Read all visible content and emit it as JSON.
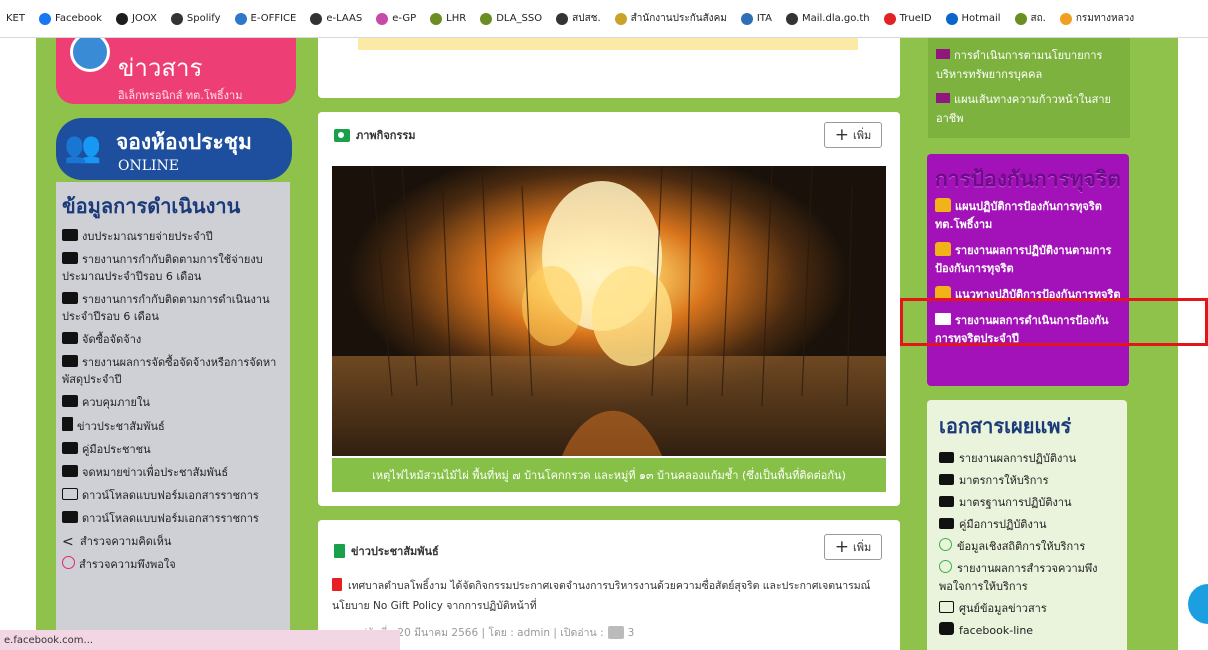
{
  "bookmarks": [
    {
      "label": "KET",
      "icon": "none",
      "color": ""
    },
    {
      "label": "Facebook",
      "icon": "facebook-icon",
      "color": "#1877f2"
    },
    {
      "label": "JOOX",
      "icon": "joox-icon",
      "color": "#1d1d1d"
    },
    {
      "label": "Spolify",
      "icon": "globe-icon",
      "color": "#333333"
    },
    {
      "label": "E-OFFICE",
      "icon": "eoffice-icon",
      "color": "#2f77c8"
    },
    {
      "label": "e-LAAS",
      "icon": "globe-icon",
      "color": "#333333"
    },
    {
      "label": "e-GP",
      "icon": "egp-icon",
      "color": "#c64aa8"
    },
    {
      "label": "LHR",
      "icon": "lhr-icon",
      "color": "#6b8e23"
    },
    {
      "label": "DLA_SSO",
      "icon": "dla-icon",
      "color": "#6b8e23"
    },
    {
      "label": "สปสช.",
      "icon": "globe-icon",
      "color": "#333333"
    },
    {
      "label": "สำนักงานประกันสังคม",
      "icon": "sso-icon",
      "color": "#c9a227"
    },
    {
      "label": "ITA",
      "icon": "ita-icon",
      "color": "#2f6fb5"
    },
    {
      "label": "Mail.dla.go.th",
      "icon": "globe-icon",
      "color": "#333333"
    },
    {
      "label": "TrueID",
      "icon": "trueid-icon",
      "color": "#e02424"
    },
    {
      "label": "Hotmail",
      "icon": "hotmail-icon",
      "color": "#0a64c9"
    },
    {
      "label": "สถ.",
      "icon": "dla-icon",
      "color": "#6b8e23"
    },
    {
      "label": "กรมทางหลวง",
      "icon": "highway-icon",
      "color": "#f0a020"
    }
  ],
  "left": {
    "news_title": "ข่าวสาร",
    "news_subtitle": "อิเล็กทรอนิกส์ ทต.โพธิ์งาม",
    "booking_title": "จองห้องประชุม",
    "booking_subtitle": "ONLINE",
    "ops_title": "ข้อมูลการดำเนินงาน",
    "ops_items": [
      {
        "label": "งบประมาณรายจ่ายประจำปี",
        "icon": "folder-icon"
      },
      {
        "label": "รายงานการกำกับติดตามการใช้จ่ายงบประมาณประจำปีรอบ 6 เดือน",
        "icon": "folder-icon"
      },
      {
        "label": "รายงานการกำกับติดตามการดำเนินงานประจำปีรอบ 6 เดือน",
        "icon": "folder-icon"
      },
      {
        "label": "จัดซื้อจัดจ้าง",
        "icon": "flag-icon"
      },
      {
        "label": "รายงานผลการจัดซื้อจัดจ้างหรือการจัดหาพัสดุประจำปี",
        "icon": "folder-icon"
      },
      {
        "label": "ควบคุมภายใน",
        "icon": "folder-icon"
      },
      {
        "label": "ข่าวประชาสัมพันธ์",
        "icon": "document-icon"
      },
      {
        "label": "คู่มือประชาชน",
        "icon": "folder-icon"
      },
      {
        "label": "จดหมายข่าวเพื่อประชาสัมพันธ์",
        "icon": "folder-icon"
      },
      {
        "label": "ดาวน์โหลดแบบฟอร์มเอกสารราชการ",
        "icon": "monitor-icon"
      },
      {
        "label": "ดาวน์โหลดแบบฟอร์มเอกสารราชการ",
        "icon": "pdf-icon"
      },
      {
        "label": "สำรวจความคิดเห็น",
        "icon": "share-icon"
      },
      {
        "label": "สำรวจความพึงพอใจ",
        "icon": "smile-icon"
      }
    ]
  },
  "activity": {
    "title": "ภาพกิจกรรม",
    "add_label": "เพิ่ม",
    "caption": "เหตุไฟไหม้สวนไม้ไผ่ พื้นที่หมู่ ๗ บ้านโคกกรวด และหมู่ที่ ๑๓ บ้านคลองแก้มช้ำ (ซึ่งเป็นพื้นที่ติดต่อกัน)"
  },
  "pr": {
    "title": "ข่าวประชาสัมพันธ์",
    "add_label": "เพิ่ม",
    "headline": "เทศบาลตำบลโพธิ์งาม ได้จัดกิจกรรมประกาศเจตจำนงการบริหารงานด้วยความซื่อสัตย์สุจริต และประกาศเจตนารมณ์นโยบาย No Gift Policy จากการปฏิบัติหน้าที่",
    "meta": "เผยแพร่วันที่ : 20 มีนาคม 2566 | โดย : admin | เปิดอ่าน :",
    "views": "3"
  },
  "right": {
    "hr_items": [
      "การดำเนินการตามนโยบายการบริหารทรัพยากรบุคคล",
      "แผนเส้นทางความก้าวหน้าในสายอาชีพ"
    ],
    "anti_title": "การป้องกันการทุจริต",
    "anti_items": [
      {
        "label": "แผนปฏิบัติการป้องกันการทุจริต ทต.โพธิ์งาม",
        "icon": "thumbs-up-icon"
      },
      {
        "label": "รายงานผลการปฏิบัติงานตามการป้องกันการทุจริต",
        "icon": "thumbs-up-icon"
      },
      {
        "label": "แนวทางปฏิบัติการป้องกันการทุจริต",
        "icon": "thumbs-up-icon"
      },
      {
        "label": "รายงานผลการดำเนินการป้องกันการทุจริตประจำปี",
        "icon": "sheet-icon"
      }
    ],
    "pub_title": "เอกสารเผยแพร่",
    "pub_items": [
      {
        "label": "รายงานผลการปฏิบัติงาน",
        "icon": "folder-icon"
      },
      {
        "label": "มาตรการให้บริการ",
        "icon": "folder-icon"
      },
      {
        "label": "มาตรฐานการปฏิบัติงาน",
        "icon": "folder-icon"
      },
      {
        "label": "คู่มือการปฏิบัติงาน",
        "icon": "folder-icon"
      },
      {
        "label": "ข้อมูลเชิงสถิติการให้บริการ",
        "icon": "smile-icon"
      },
      {
        "label": "รายงานผลการสำรวจความพึงพอใจการให้บริการ",
        "icon": "smile-icon"
      },
      {
        "label": "ศูนย์ข้อมูลข่าวสาร",
        "icon": "monitor-icon"
      },
      {
        "label": "facebook-line",
        "icon": "thumbs-up-icon"
      }
    ]
  },
  "status_url": "e.facebook.com..."
}
